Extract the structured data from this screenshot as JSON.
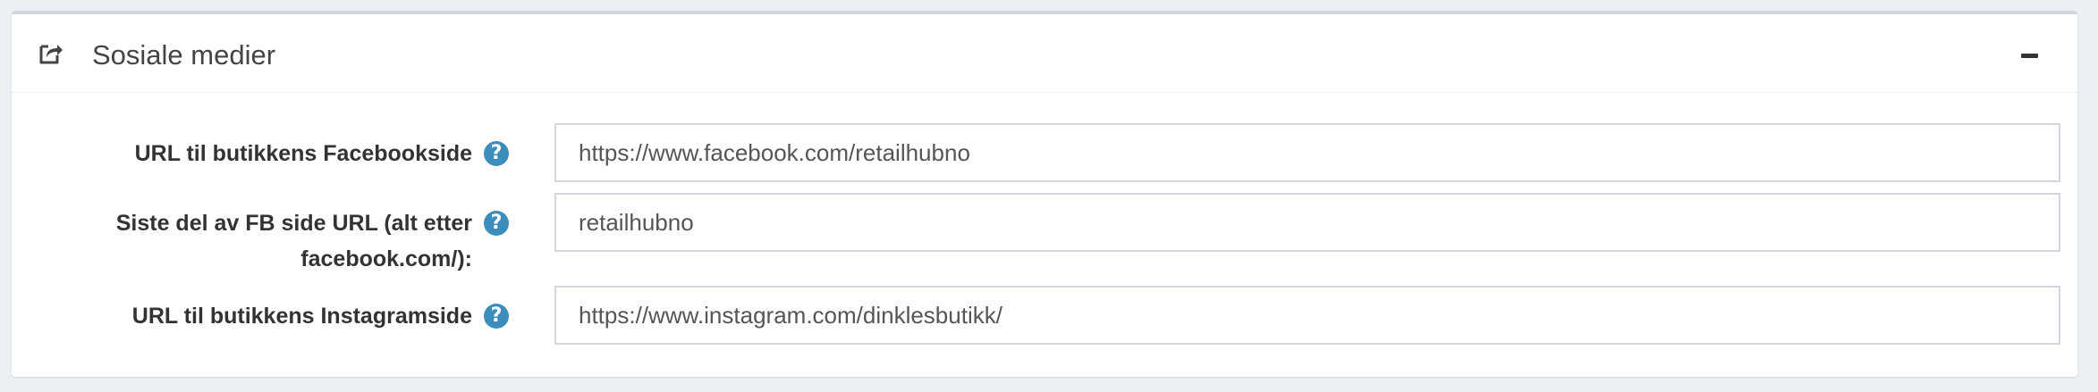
{
  "panel": {
    "title": "Sosiale medier",
    "header_icon": "share-square-icon",
    "collapse_icon": "minus-icon"
  },
  "fields": [
    {
      "label": "URL til butikkens Facebookside",
      "value": "https://www.facebook.com/retailhubno",
      "help_icon": "question-circle-icon"
    },
    {
      "label_line1": "Siste del av FB side URL (alt etter",
      "label_line2": "facebook.com/):",
      "value": "retailhubno",
      "help_icon": "question-circle-icon"
    },
    {
      "label": "URL til butikkens Instagramside",
      "value": "https://www.instagram.com/dinklesbutikk/",
      "help_icon": "question-circle-icon"
    }
  ],
  "colors": {
    "background": "#ecf0f5",
    "panel_border": "#d2d6de",
    "help_icon": "#3c8dbc",
    "text": "#333333"
  }
}
